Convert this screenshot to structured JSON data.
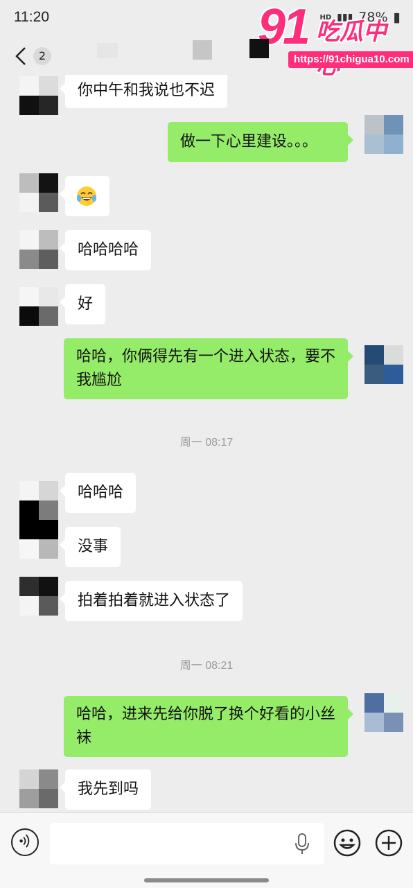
{
  "status_bar": {
    "time": "11:20",
    "hd": "HD",
    "battery": "78%"
  },
  "watermark": {
    "number": "91",
    "brand": "吃瓜中心",
    "url": "https://91chigua10.com"
  },
  "nav": {
    "unread_count": "2"
  },
  "messages": [
    {
      "side": "in",
      "text": "你中午和我说也不迟"
    },
    {
      "side": "out",
      "text": "做一下心里建设。。。"
    },
    {
      "side": "in",
      "text": "",
      "emoji": "laughing-crying-emoji"
    },
    {
      "side": "in",
      "text": "哈哈哈哈"
    },
    {
      "side": "in",
      "text": "好"
    },
    {
      "side": "out",
      "text": "哈哈，你俩得先有一个进入状态，要不我尴尬"
    },
    {
      "side": "in",
      "text": "哈哈哈"
    },
    {
      "side": "in",
      "text": "没事"
    },
    {
      "side": "in",
      "text": "拍着拍着就进入状态了"
    },
    {
      "side": "out",
      "text": "哈哈，进来先给你脱了换个好看的小丝袜"
    },
    {
      "side": "in",
      "text": "我先到吗"
    }
  ],
  "timestamps": [
    "周一 08:17",
    "周一 08:21"
  ],
  "colors": {
    "out_bubble": "#95ec69",
    "in_bubble": "#ffffff",
    "background": "#ededed",
    "watermark": "#ff2d7a"
  },
  "input_bar": {
    "icons": [
      "voice-icon",
      "microphone-icon",
      "emoji-icon",
      "plus-icon"
    ]
  }
}
